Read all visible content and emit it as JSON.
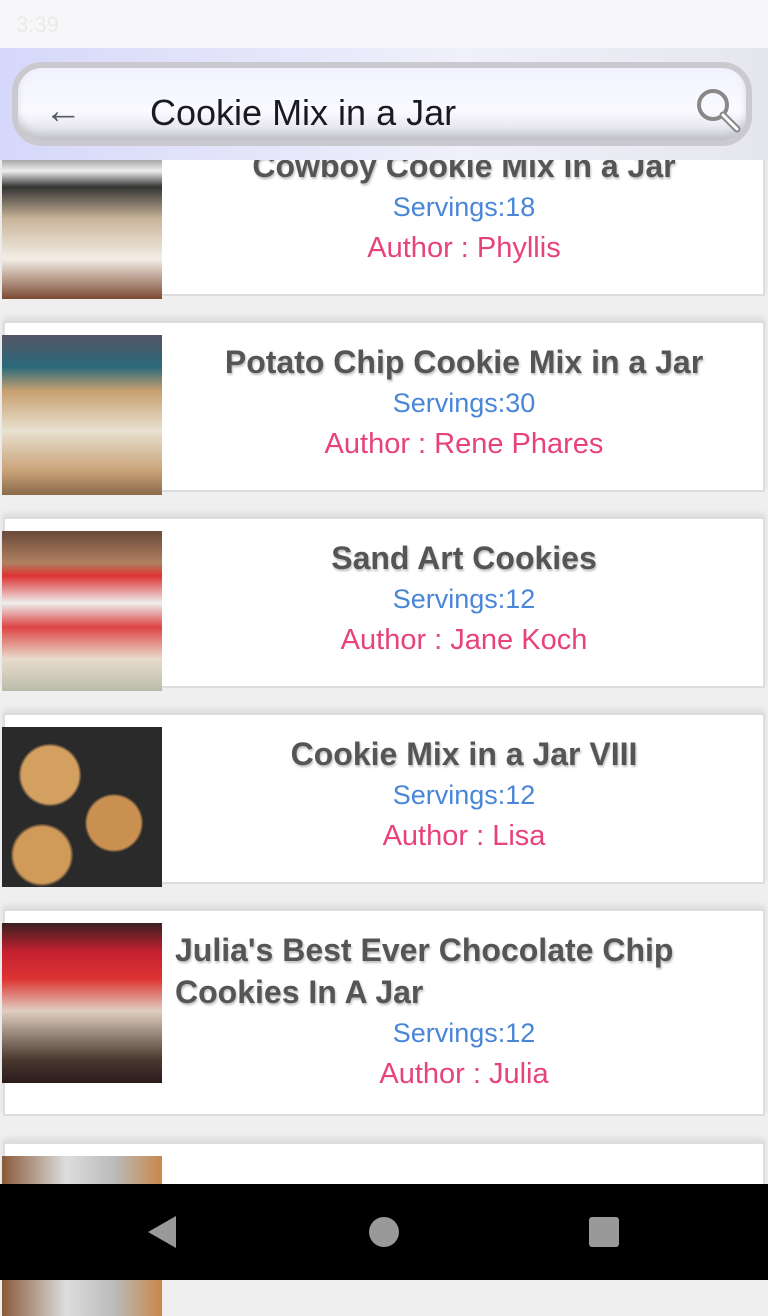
{
  "status": {
    "time": "3:39"
  },
  "header": {
    "query": "Cookie Mix in a Jar",
    "back_icon": "arrow-left-icon",
    "search_icon": "magnifier-icon"
  },
  "recipes": [
    {
      "title": "Cowboy Cookie Mix in a Jar",
      "servings": "Servings:18",
      "author": "Author : Phyllis"
    },
    {
      "title": "Potato Chip Cookie Mix in a Jar",
      "servings": "Servings:30",
      "author": "Author : Rene Phares"
    },
    {
      "title": "Sand Art Cookies",
      "servings": "Servings:12",
      "author": "Author : Jane Koch"
    },
    {
      "title": "Cookie Mix in a Jar VIII",
      "servings": "Servings:12",
      "author": "Author : Lisa"
    },
    {
      "title": "Julia's Best Ever Chocolate Chip Cookies In A Jar",
      "servings": "Servings:12",
      "author": "Author : Julia"
    }
  ],
  "colors": {
    "servings": "#4a86d8",
    "author": "#e8427c",
    "title": "#555555"
  }
}
